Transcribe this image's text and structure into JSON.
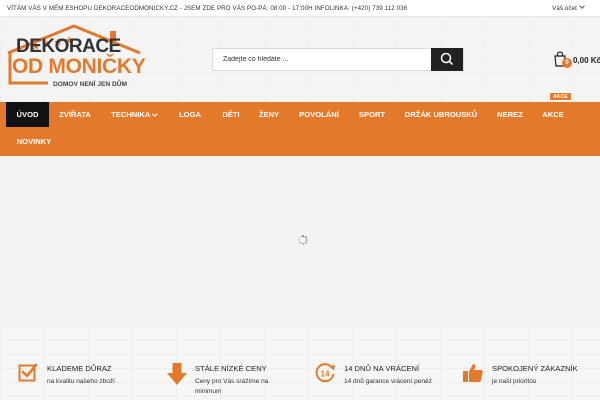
{
  "topbar": {
    "message": "VÍTÁM VÁS V MÉM ESHOPU DEKORACEODMONICKY.CZ - JSEM ZDE PRO VÁS PO-PÁ: 08:00 - 17:00H  INFOLINKA: (+420) 739 112 036",
    "account_label": "Váš účet"
  },
  "logo": {
    "line1": "DEKORACE",
    "line2": "OD MONIČKY",
    "tagline": "DOMOV NENÍ JEN DŮM"
  },
  "search": {
    "placeholder": "Zadejte co hledáte ..."
  },
  "cart": {
    "count": "0",
    "total": "0,00 Kč"
  },
  "nav": {
    "items": [
      {
        "label": "ÚVOD"
      },
      {
        "label": "ZVÍŘATA"
      },
      {
        "label": "TECHNIKA"
      },
      {
        "label": "LOGA"
      },
      {
        "label": "DĚTI"
      },
      {
        "label": "ŽENY"
      },
      {
        "label": "POVOLÁNÍ"
      },
      {
        "label": "SPORT"
      },
      {
        "label": "DRŽÁK UBROUSKŮ"
      },
      {
        "label": "NEREZ"
      },
      {
        "label": "AKCE"
      },
      {
        "label": "NOVINKY"
      }
    ],
    "akce_badge": "AKCE"
  },
  "features": [
    {
      "title": "KLADEME DŮRAZ",
      "desc": "na kvalitu našeho zboží",
      "icon": "checkbox-icon"
    },
    {
      "title": "STÁLE NÍZKÉ CENY",
      "desc": "Ceny pro Vás srážíme na minimum",
      "icon": "arrow-down-icon"
    },
    {
      "title": "14 DNŮ NA VRÁCENÍ",
      "desc": "14 dnů garance vrácení peněz",
      "icon": "return-14-icon"
    },
    {
      "title": "SPOKOJENÝ ZÁKAZNÍK",
      "desc": "je naší prioritou",
      "icon": "thumbs-up-icon"
    }
  ],
  "colors": {
    "accent": "#e37a2b",
    "dark": "#111111"
  }
}
